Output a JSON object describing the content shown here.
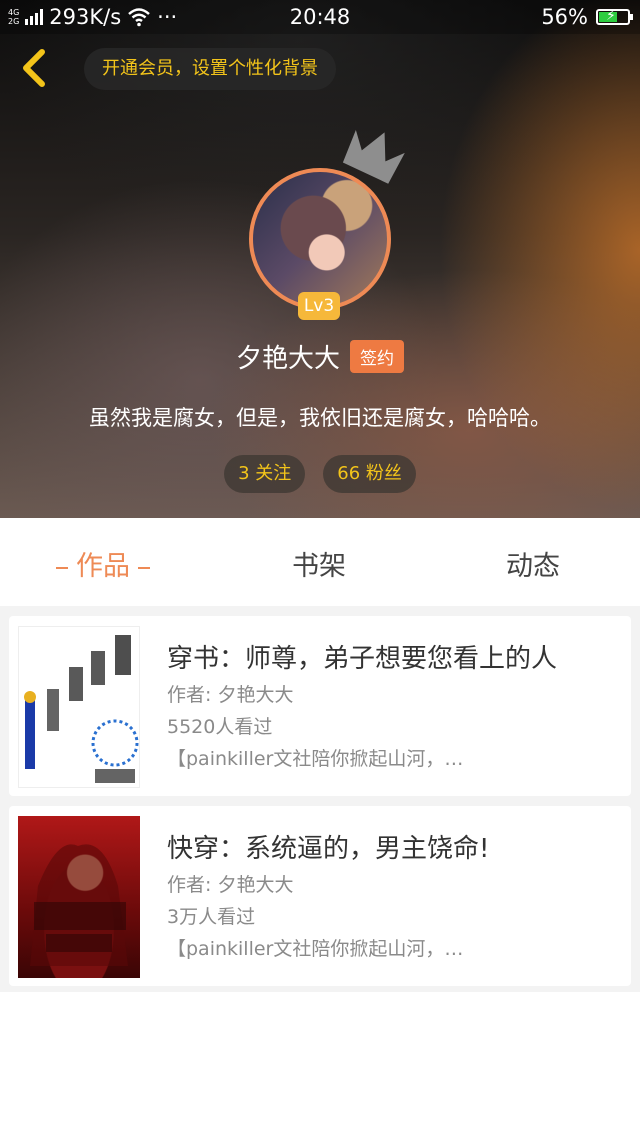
{
  "status_bar": {
    "network_top": "4G",
    "network_bottom": "2G",
    "speed": "293K/s",
    "dots": "···",
    "time": "20:48",
    "battery": "56%"
  },
  "header": {
    "vip_prompt": "开通会员，设置个性化背景",
    "level": "Lv3",
    "username": "夕艳大大",
    "signed_badge": "签约",
    "bio": "虽然我是腐女，但是，我依旧还是腐女，哈哈哈。",
    "following": "3 关注",
    "followers": "66 粉丝"
  },
  "tabs": {
    "works": "作品",
    "bookshelf": "书架",
    "activity": "动态"
  },
  "books": [
    {
      "title": "穿书：师尊，弟子想要您看上的人",
      "author": "作者: 夕艳大大",
      "views": "5520人看过",
      "desc": "【painkiller文社陪你掀起山河，…"
    },
    {
      "title": "快穿：系统逼的，男主饶命!",
      "author": "作者: 夕艳大大",
      "views": "3万人看过",
      "desc": "【painkiller文社陪你掀起山河，…"
    }
  ],
  "colors": {
    "accent": "#ee8a55",
    "gold": "#f3c41a",
    "signed_bg": "#ee7a42"
  }
}
